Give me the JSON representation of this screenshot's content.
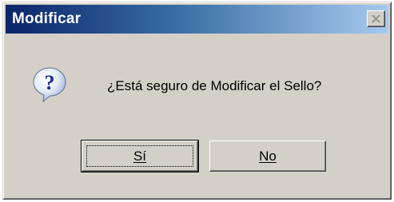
{
  "dialog": {
    "title": "Modificar",
    "message": "¿Está seguro de Modificar el Sello?",
    "icon": "question-icon",
    "close_icon": "close-icon"
  },
  "buttons": {
    "yes_label": "Sí",
    "no_label": "No"
  },
  "colors": {
    "title_start": "#0a246a",
    "title_end": "#a6caf0",
    "face": "#d4d0c8"
  }
}
